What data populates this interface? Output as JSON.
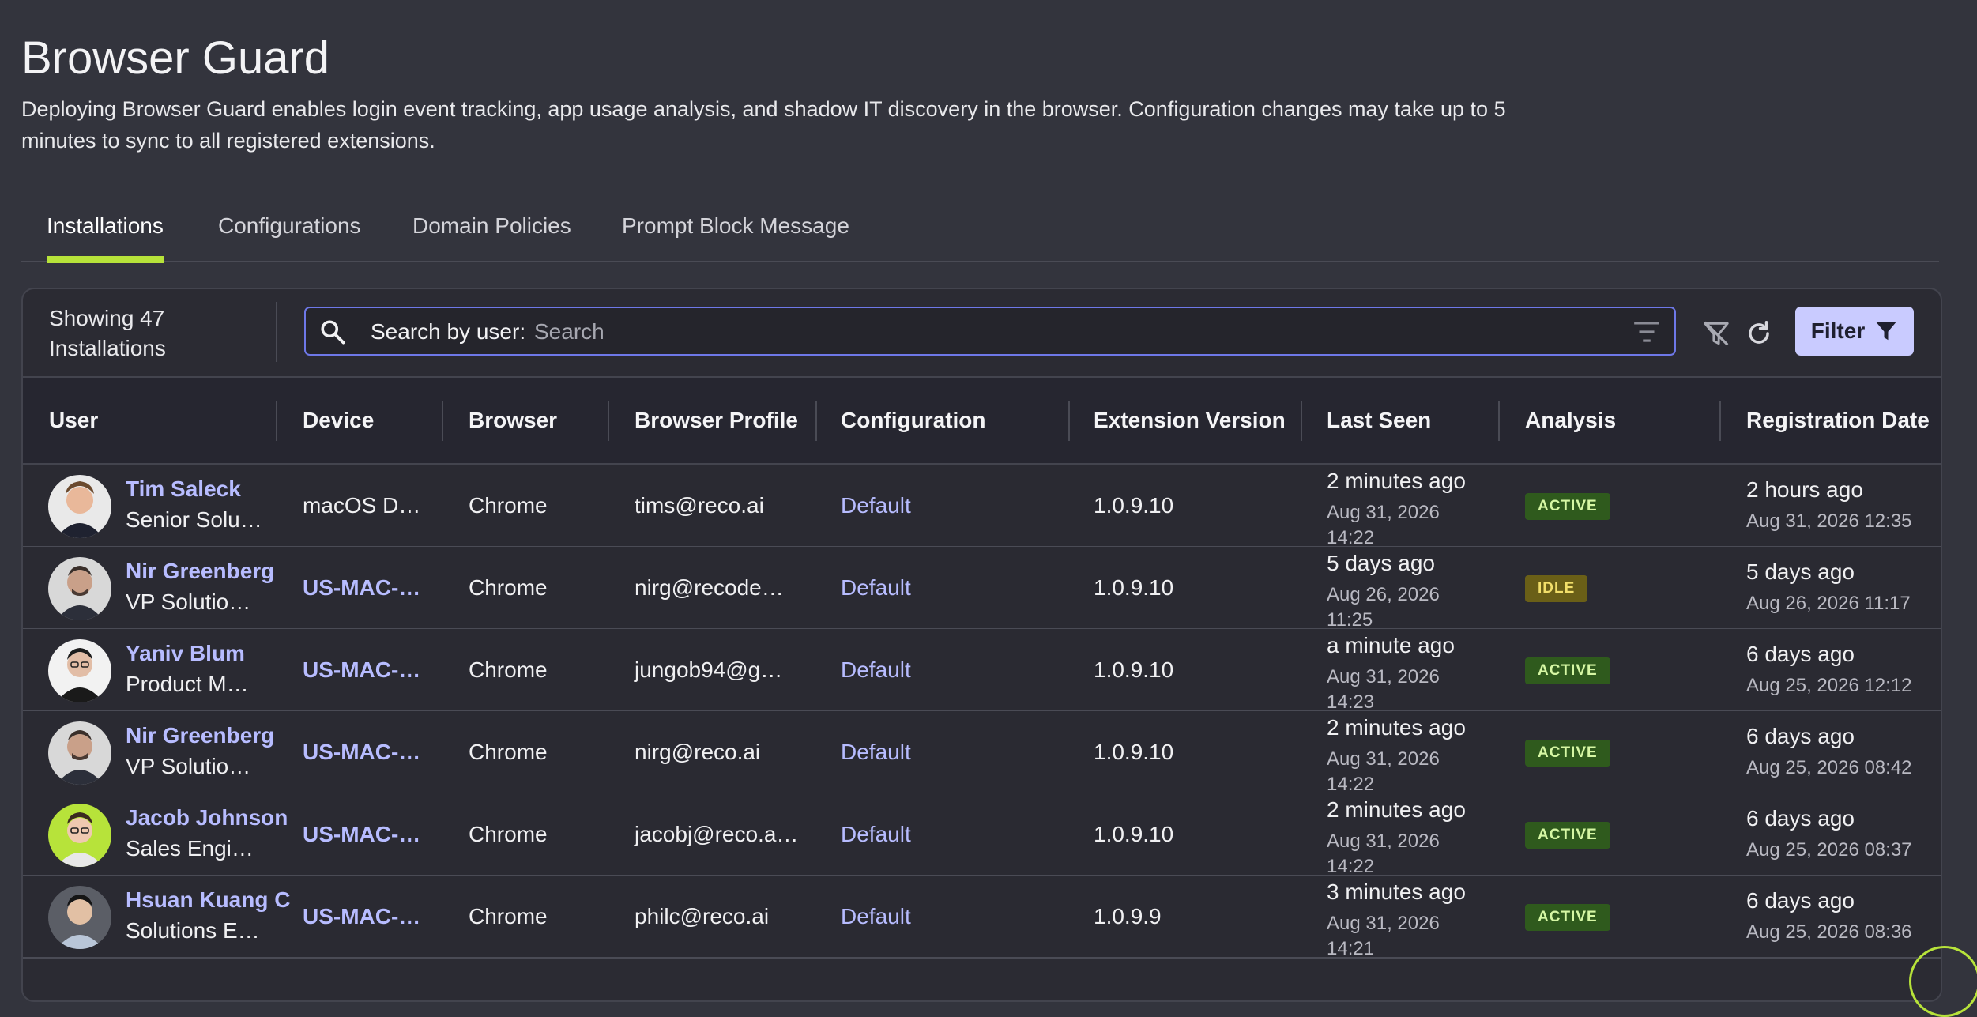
{
  "page": {
    "title": "Browser Guard",
    "description": "Deploying Browser Guard enables login event tracking, app usage analysis, and shadow IT discovery in the browser. Configuration changes may take up to 5 minutes to sync to all registered extensions."
  },
  "tabs": [
    {
      "label": "Installations",
      "active": true
    },
    {
      "label": "Configurations",
      "active": false
    },
    {
      "label": "Domain Policies",
      "active": false
    },
    {
      "label": "Prompt Block Message",
      "active": false
    }
  ],
  "toolbar": {
    "count_text": "Showing 47 Installations",
    "search_label": "Search by user:",
    "search_placeholder": "Search",
    "search_value": "",
    "filter_label": "Filter"
  },
  "columns": [
    "User",
    "Device",
    "Browser",
    "Browser Profile",
    "Configuration",
    "Extension Version",
    "Last Seen",
    "Analysis",
    "Registration Date"
  ],
  "rows": [
    {
      "name": "Tim Saleck",
      "title": "Senior Solu…",
      "device": "macOS D…",
      "device_link": false,
      "browser": "Chrome",
      "profile": "tims@reco.ai",
      "config": "Default",
      "version": "1.0.9.10",
      "seen": "2 minutes ago",
      "seen_detail": "Aug 31, 2026 14:22",
      "analysis": "ACTIVE",
      "reg": "2 hours ago",
      "reg_detail": "Aug 31, 2026 12:35"
    },
    {
      "name": "Nir Greenberg",
      "title": "VP Solutio…",
      "device": "US-MAC-…",
      "device_link": true,
      "browser": "Chrome",
      "profile": "nirg@recode…",
      "config": "Default",
      "version": "1.0.9.10",
      "seen": "5 days ago",
      "seen_detail": "Aug 26, 2026 11:25",
      "analysis": "IDLE",
      "reg": "5 days ago",
      "reg_detail": "Aug 26, 2026 11:17"
    },
    {
      "name": "Yaniv Blum",
      "title": "Product M…",
      "device": "US-MAC-…",
      "device_link": true,
      "browser": "Chrome",
      "profile": "jungob94@g…",
      "config": "Default",
      "version": "1.0.9.10",
      "seen": "a minute ago",
      "seen_detail": "Aug 31, 2026 14:23",
      "analysis": "ACTIVE",
      "reg": "6 days ago",
      "reg_detail": "Aug 25, 2026 12:12"
    },
    {
      "name": "Nir Greenberg",
      "title": "VP Solutio…",
      "device": "US-MAC-…",
      "device_link": true,
      "browser": "Chrome",
      "profile": "nirg@reco.ai",
      "config": "Default",
      "version": "1.0.9.10",
      "seen": "2 minutes ago",
      "seen_detail": "Aug 31, 2026 14:22",
      "analysis": "ACTIVE",
      "reg": "6 days ago",
      "reg_detail": "Aug 25, 2026 08:42"
    },
    {
      "name": "Jacob Johnson",
      "title": "Sales Engi…",
      "device": "US-MAC-…",
      "device_link": true,
      "browser": "Chrome",
      "profile": "jacobj@reco.a…",
      "config": "Default",
      "version": "1.0.9.10",
      "seen": "2 minutes ago",
      "seen_detail": "Aug 31, 2026 14:22",
      "analysis": "ACTIVE",
      "reg": "6 days ago",
      "reg_detail": "Aug 25, 2026 08:37"
    },
    {
      "name": "Hsuan Kuang C",
      "title": "Solutions E…",
      "device": "US-MAC-…",
      "device_link": true,
      "browser": "Chrome",
      "profile": "philc@reco.ai",
      "config": "Default",
      "version": "1.0.9.9",
      "seen": "3 minutes ago",
      "seen_detail": "Aug 31, 2026 14:21",
      "analysis": "ACTIVE",
      "reg": "6 days ago",
      "reg_detail": "Aug 25, 2026 08:36"
    }
  ],
  "colors": {
    "accent": "#b7e33a",
    "link": "#b7bcff",
    "filter_button": "#c9cbff",
    "active_badge": "#2f5a1d",
    "idle_badge": "#6a5f17"
  },
  "icons": [
    "search-icon",
    "filter-lines-icon",
    "clear-filter-icon",
    "refresh-icon",
    "funnel-icon",
    "avatar"
  ]
}
